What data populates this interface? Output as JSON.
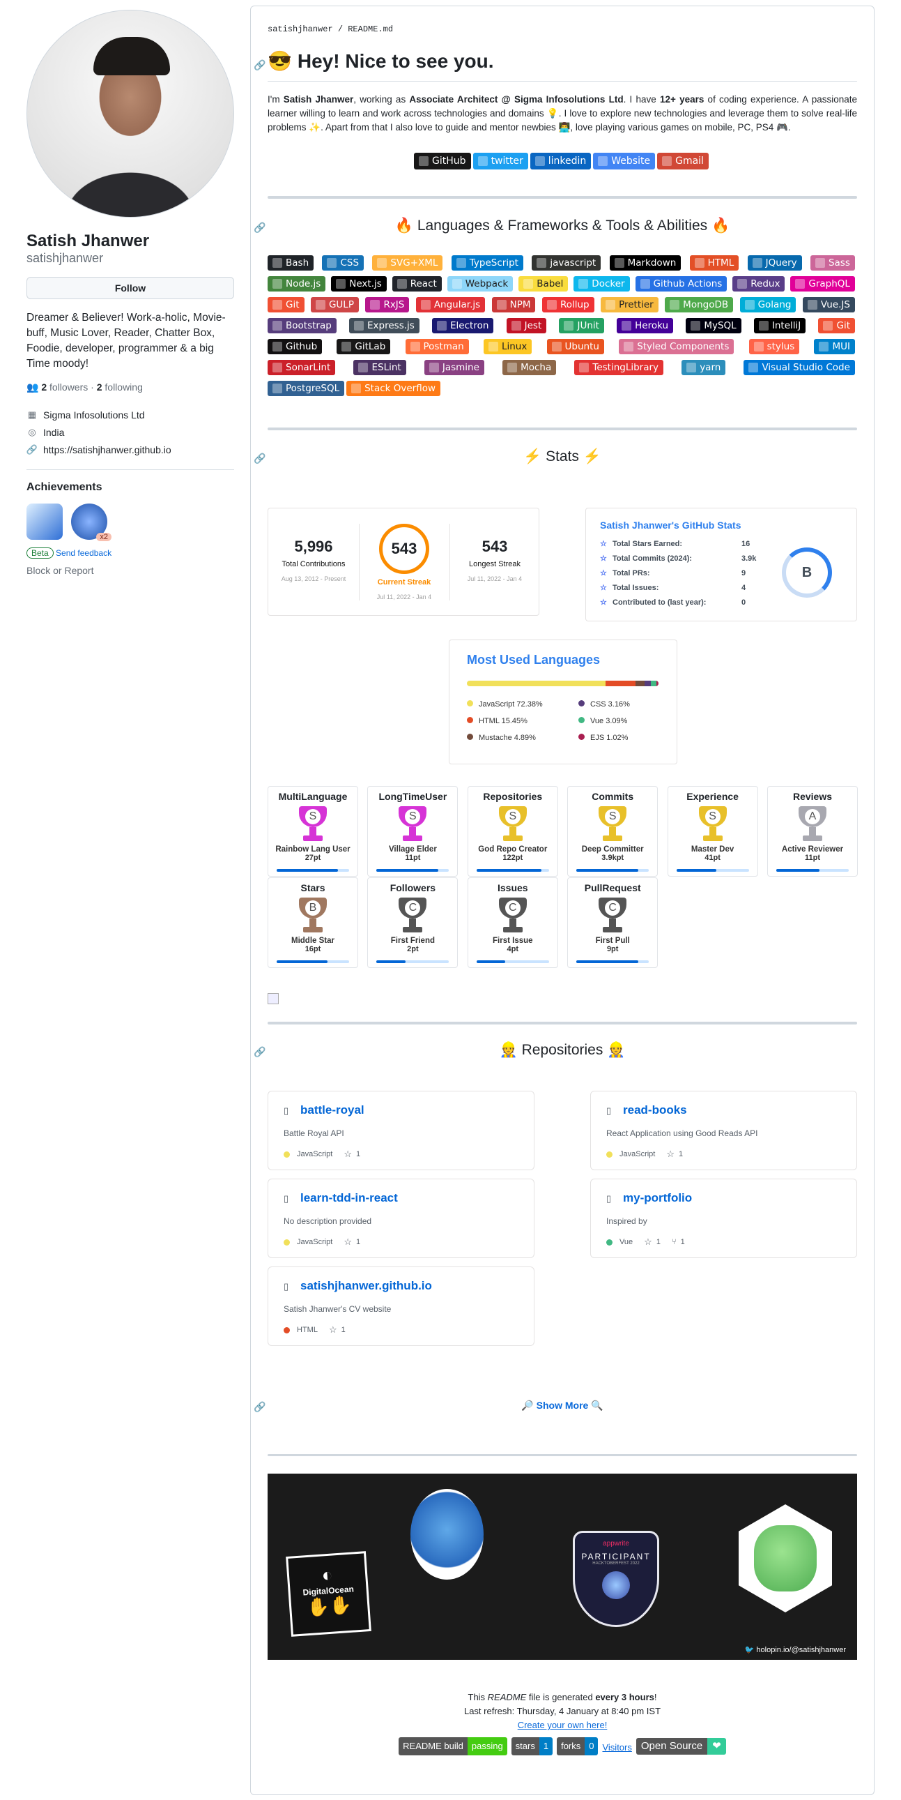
{
  "sidebar": {
    "name": "Satish Jhanwer",
    "login": "satishjhanwer",
    "follow_label": "Follow",
    "bio": "Dreamer & Believer! Work-a-holic, Movie-buff, Music Lover, Reader, Chatter Box, Foodie, developer, programmer & a big Time moody!",
    "followers": "2",
    "followers_label": " followers · ",
    "following": "2",
    "following_label": " following",
    "company": "Sigma Infosolutions Ltd",
    "location": "India",
    "website": "https://satishjhanwer.github.io",
    "achievements_title": "Achievements",
    "achievement_count": "x2",
    "beta": "Beta",
    "feedback": "Send feedback",
    "block": "Block or Report"
  },
  "readme": {
    "crumb_user": "satishjhanwer",
    "crumb_sep": " / ",
    "crumb_file": "README.md",
    "title": "Hey! Nice to see you.",
    "intro_parts": [
      "I'm ",
      "Satish Jhanwer",
      ", working as ",
      "Associate Architect @ Sigma Infosolutions Ltd",
      ". I have ",
      "12+ years",
      " of coding experience. A passionate learner willing to learn and work across technologies and domains 💡. I love to explore new technologies and leverage them to solve real-life problems ✨. Apart from that I also love to guide and mentor newbies 👨‍💻, love playing various games on mobile, PC, PS4 🎮."
    ],
    "social": [
      {
        "label": "GitHub",
        "color": "#181717"
      },
      {
        "label": "twitter",
        "color": "#1ca0f1"
      },
      {
        "label": "linkedin",
        "color": "#0a66c2"
      },
      {
        "label": "Website",
        "color": "#4285f4"
      },
      {
        "label": "Gmail",
        "color": "#d14836"
      }
    ],
    "lang_title": "Languages & Frameworks & Tools & Abilities",
    "skills": [
      {
        "label": "Bash",
        "color": "#1f2328"
      },
      {
        "label": "CSS",
        "color": "#1572b6"
      },
      {
        "label": "SVG+XML",
        "color": "#ffb13b"
      },
      {
        "label": "TypeScript",
        "color": "#007acc"
      },
      {
        "label": "javascript",
        "color": "#323330"
      },
      {
        "label": "Markdown",
        "color": "#000000"
      },
      {
        "label": "HTML",
        "color": "#e34f26"
      },
      {
        "label": "JQuery",
        "color": "#0769ad"
      },
      {
        "label": "Sass",
        "color": "#cc6699"
      },
      {
        "label": "Node.js",
        "color": "#43853d"
      },
      {
        "label": "Next.js",
        "color": "#000000"
      },
      {
        "label": "React",
        "color": "#20232a"
      },
      {
        "label": "Webpack",
        "color": "#8dd6f9"
      },
      {
        "label": "Babel",
        "color": "#f9dc3e"
      },
      {
        "label": "Docker",
        "color": "#0db7ed"
      },
      {
        "label": "Github Actions",
        "color": "#2671e5"
      },
      {
        "label": "Redux",
        "color": "#593d88"
      },
      {
        "label": "GraphQL",
        "color": "#e10098"
      },
      {
        "label": "Git",
        "color": "#f05033"
      },
      {
        "label": "GULP",
        "color": "#cf4647"
      },
      {
        "label": "RxJS",
        "color": "#b7178c"
      },
      {
        "label": "Angular.js",
        "color": "#e23237"
      },
      {
        "label": "NPM",
        "color": "#cb3837"
      },
      {
        "label": "Rollup",
        "color": "#ef3335"
      },
      {
        "label": "Prettier",
        "color": "#f7b93e"
      },
      {
        "label": "MongoDB",
        "color": "#4ea94b"
      },
      {
        "label": "Golang",
        "color": "#00add8"
      },
      {
        "label": "Vue.JS",
        "color": "#35495e"
      },
      {
        "label": "Bootstrap",
        "color": "#563d7c"
      },
      {
        "label": "Express.js",
        "color": "#404d59"
      },
      {
        "label": "Electron",
        "color": "#191970"
      },
      {
        "label": "Jest",
        "color": "#c21325"
      },
      {
        "label": "JUnit",
        "color": "#25a162"
      },
      {
        "label": "Heroku",
        "color": "#430098"
      },
      {
        "label": "MySQL",
        "color": "#00000f"
      },
      {
        "label": "IntelliJ",
        "color": "#000000"
      },
      {
        "label": "Git",
        "color": "#f05033"
      },
      {
        "label": "Github",
        "color": "#121011"
      },
      {
        "label": "GitLab",
        "color": "#181717"
      },
      {
        "label": "Postman",
        "color": "#ff6c37"
      },
      {
        "label": "Linux",
        "color": "#fcc624"
      },
      {
        "label": "Ubuntu",
        "color": "#e95420"
      },
      {
        "label": "Styled Components",
        "color": "#db7093"
      },
      {
        "label": "stylus",
        "color": "#ff6347"
      },
      {
        "label": "MUI",
        "color": "#0081cb"
      },
      {
        "label": "SonarLint",
        "color": "#cb2029"
      },
      {
        "label": "ESLint",
        "color": "#4b3263"
      },
      {
        "label": "Jasmine",
        "color": "#8a4182"
      },
      {
        "label": "Mocha",
        "color": "#8d6748"
      },
      {
        "label": "TestingLibrary",
        "color": "#e33332"
      },
      {
        "label": "yarn",
        "color": "#2c8ebb"
      },
      {
        "label": "Visual Studio Code",
        "color": "#0078d7"
      },
      {
        "label": "PostgreSQL",
        "color": "#316192"
      },
      {
        "label": "Stack Overflow",
        "color": "#fe7a16"
      }
    ],
    "stats_title": "Stats",
    "streak": {
      "total": "5,996",
      "total_label": "Total Contributions",
      "total_range": "Aug 13, 2012 - Present",
      "current": "543",
      "current_label": "Current Streak",
      "current_range": "Jul 11, 2022 - Jan 4",
      "longest": "543",
      "longest_label": "Longest Streak",
      "longest_range": "Jul 11, 2022 - Jan 4"
    },
    "ghstats": {
      "title": "Satish Jhanwer's GitHub Stats",
      "rows": [
        {
          "k": "Total Stars Earned:",
          "v": "16"
        },
        {
          "k": "Total Commits (2024):",
          "v": "3.9k"
        },
        {
          "k": "Total PRs:",
          "v": "9"
        },
        {
          "k": "Total Issues:",
          "v": "4"
        },
        {
          "k": "Contributed to (last year):",
          "v": "0"
        }
      ],
      "rank": "B"
    },
    "languages": {
      "title": "Most Used Languages",
      "items": [
        {
          "name": "JavaScript 72.38%",
          "pct": 72.38,
          "color": "#f1e05a"
        },
        {
          "name": "CSS 3.16%",
          "pct": 3.16,
          "color": "#563d7c"
        },
        {
          "name": "HTML 15.45%",
          "pct": 15.45,
          "color": "#e34c26"
        },
        {
          "name": "Vue 3.09%",
          "pct": 3.09,
          "color": "#41b883"
        },
        {
          "name": "Mustache 4.89%",
          "pct": 4.89,
          "color": "#724b3b"
        },
        {
          "name": "EJS 1.02%",
          "pct": 1.02,
          "color": "#a91e50"
        }
      ]
    },
    "trophies": [
      {
        "t": "MultiLanguage",
        "rank": "S",
        "name": "Rainbow Lang User",
        "pt": "27pt",
        "progress": 0.85,
        "cup": "#d633d6"
      },
      {
        "t": "LongTimeUser",
        "rank": "S",
        "name": "Village Elder",
        "pt": "11pt",
        "progress": 0.85,
        "cup": "#d633d6"
      },
      {
        "t": "Repositories",
        "rank": "S",
        "name": "God Repo Creator",
        "pt": "122pt",
        "progress": 0.9,
        "cup": "#e8c02a"
      },
      {
        "t": "Commits",
        "rank": "S",
        "name": "Deep Committer",
        "pt": "3.9kpt",
        "progress": 0.85,
        "cup": "#e8c02a"
      },
      {
        "t": "Experience",
        "rank": "S",
        "name": "Master Dev",
        "pt": "41pt",
        "progress": 0.55,
        "cup": "#e8c02a"
      },
      {
        "t": "Reviews",
        "rank": "A",
        "name": "Active Reviewer",
        "pt": "11pt",
        "progress": 0.6,
        "cup": "#a8a8b0"
      },
      {
        "t": "Stars",
        "rank": "B",
        "name": "Middle Star",
        "pt": "16pt",
        "progress": 0.7,
        "cup": "#a07860"
      },
      {
        "t": "Followers",
        "rank": "C",
        "name": "First Friend",
        "pt": "2pt",
        "progress": 0.4,
        "cup": "#555"
      },
      {
        "t": "Issues",
        "rank": "C",
        "name": "First Issue",
        "pt": "4pt",
        "progress": 0.4,
        "cup": "#555"
      },
      {
        "t": "PullRequest",
        "rank": "C",
        "name": "First Pull",
        "pt": "9pt",
        "progress": 0.85,
        "cup": "#555"
      }
    ],
    "repos_title": "Repositories",
    "repos": [
      {
        "name": "battle-royal",
        "desc": "Battle Royal API",
        "lang": "JavaScript",
        "lang_color": "#f1e05a",
        "stars": "1",
        "forks": ""
      },
      {
        "name": "read-books",
        "desc": "React Application using Good Reads API",
        "lang": "JavaScript",
        "lang_color": "#f1e05a",
        "stars": "1",
        "forks": ""
      },
      {
        "name": "learn-tdd-in-react",
        "desc": "No description provided",
        "lang": "JavaScript",
        "lang_color": "#f1e05a",
        "stars": "1",
        "forks": ""
      },
      {
        "name": "my-portfolio",
        "desc": "Inspired by",
        "lang": "Vue",
        "lang_color": "#41b883",
        "stars": "1",
        "forks": "1"
      },
      {
        "name": "satishjhanwer.github.io",
        "desc": "Satish Jhanwer's CV website",
        "lang": "HTML",
        "lang_color": "#e34c26",
        "stars": "1",
        "forks": ""
      }
    ],
    "show_more": "🔎 Show More 🔍",
    "holopin": {
      "credit": "holopin.io/@satishjhanwer",
      "do_label": "DigitalOcean",
      "appwrite": "appwrite",
      "participant": "PARTICIPANT",
      "hf": "HACKTOBERFEST 2022"
    },
    "footer": {
      "line1a": "This ",
      "line1b": "README",
      "line1c": " file is generated ",
      "line1d": "every 3 hours",
      "line1e": "!",
      "line2": "Last refresh: Thursday, 4 January at 8:40 pm IST",
      "link": "Create your own here!"
    },
    "badges": {
      "build": "README build",
      "passing": "passing",
      "stars": "stars",
      "stars_n": "1",
      "forks": "forks",
      "forks_n": "0",
      "visitors": "Visitors",
      "open": "Open Source",
      "heart": "❤"
    }
  }
}
